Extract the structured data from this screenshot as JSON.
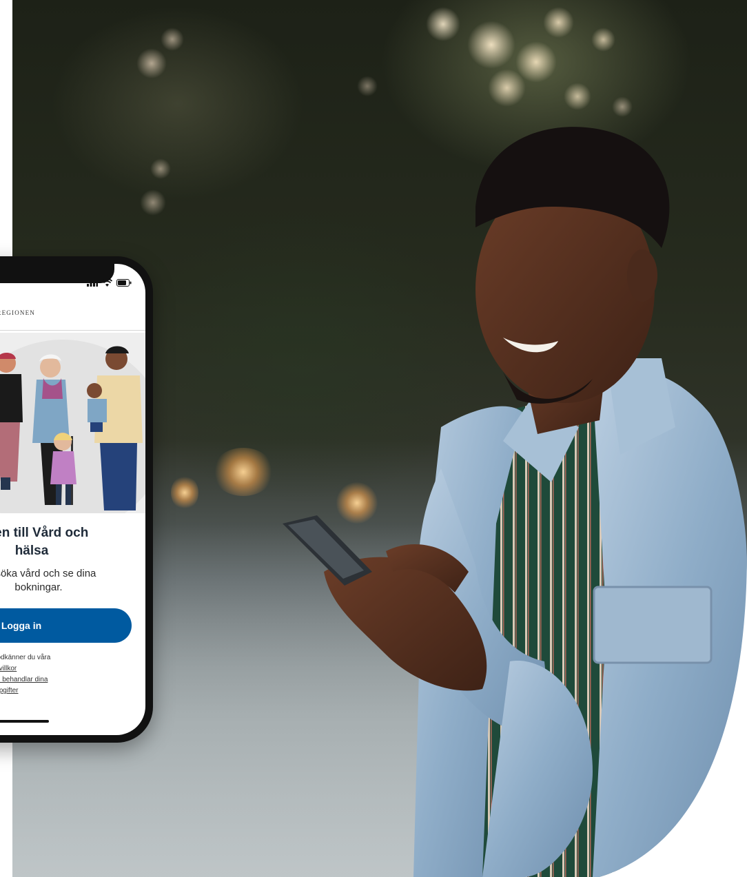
{
  "app": {
    "brand": "REGIONEN",
    "welcome_title_line1": "umen till Vård och",
    "welcome_title_line2": "hälsa",
    "welcome_sub_line1": "att söka vård och se dina",
    "welcome_sub_line2": "bokningar.",
    "login_label": "Logga in",
    "terms_line1": "fortsätta godkänner du våra",
    "terms_link1": "användarvillkor",
    "terms_line3_prefix": "om",
    "terms_link2": "hur vi behandlar dina",
    "terms_link3": "personuppgifter",
    "accent_color": "#005aa0"
  },
  "status_bar": {
    "signal_icon": "signal-bars-icon",
    "wifi_icon": "wifi-icon",
    "battery_icon": "battery-icon"
  }
}
